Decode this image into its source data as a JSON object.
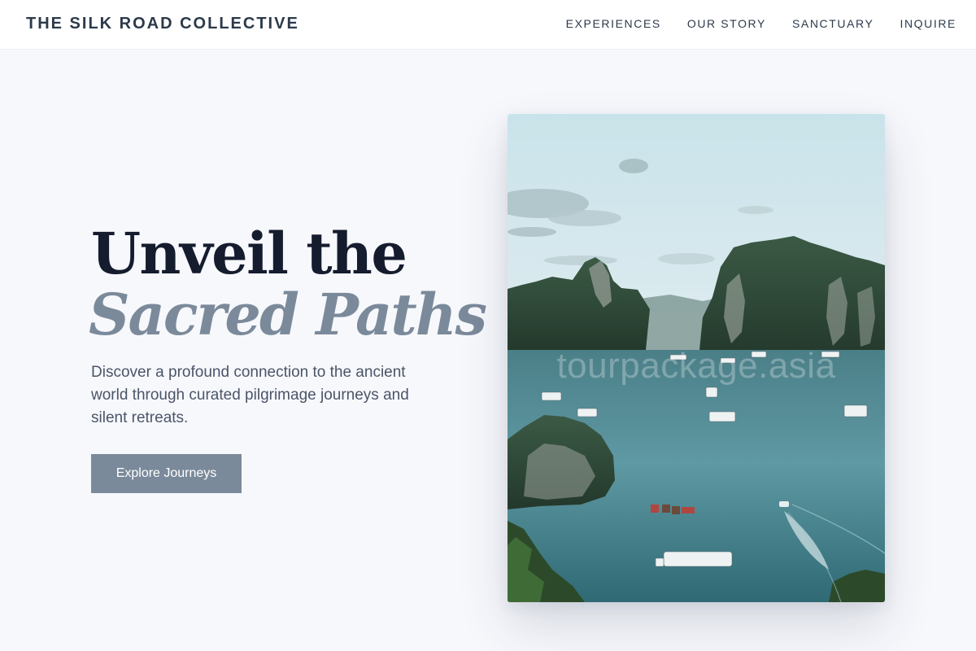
{
  "header": {
    "brand": "THE SILK ROAD COLLECTIVE",
    "nav": [
      {
        "label": "EXPERIENCES"
      },
      {
        "label": "OUR STORY"
      },
      {
        "label": "SANCTUARY"
      },
      {
        "label": "INQUIRE"
      }
    ]
  },
  "hero": {
    "title_line1": "Unveil the",
    "title_line2": "Sacred Paths",
    "description": "Discover a profound connection to the ancient world through curated pilgrimage journeys and silent retreats.",
    "cta_label": "Explore Journeys"
  },
  "photo": {
    "watermark": "tourpackage.asia"
  },
  "colors": {
    "background": "#f7f8fc",
    "heading": "#141c2e",
    "accent": "#7b8a9b",
    "text": "#4a5568"
  }
}
